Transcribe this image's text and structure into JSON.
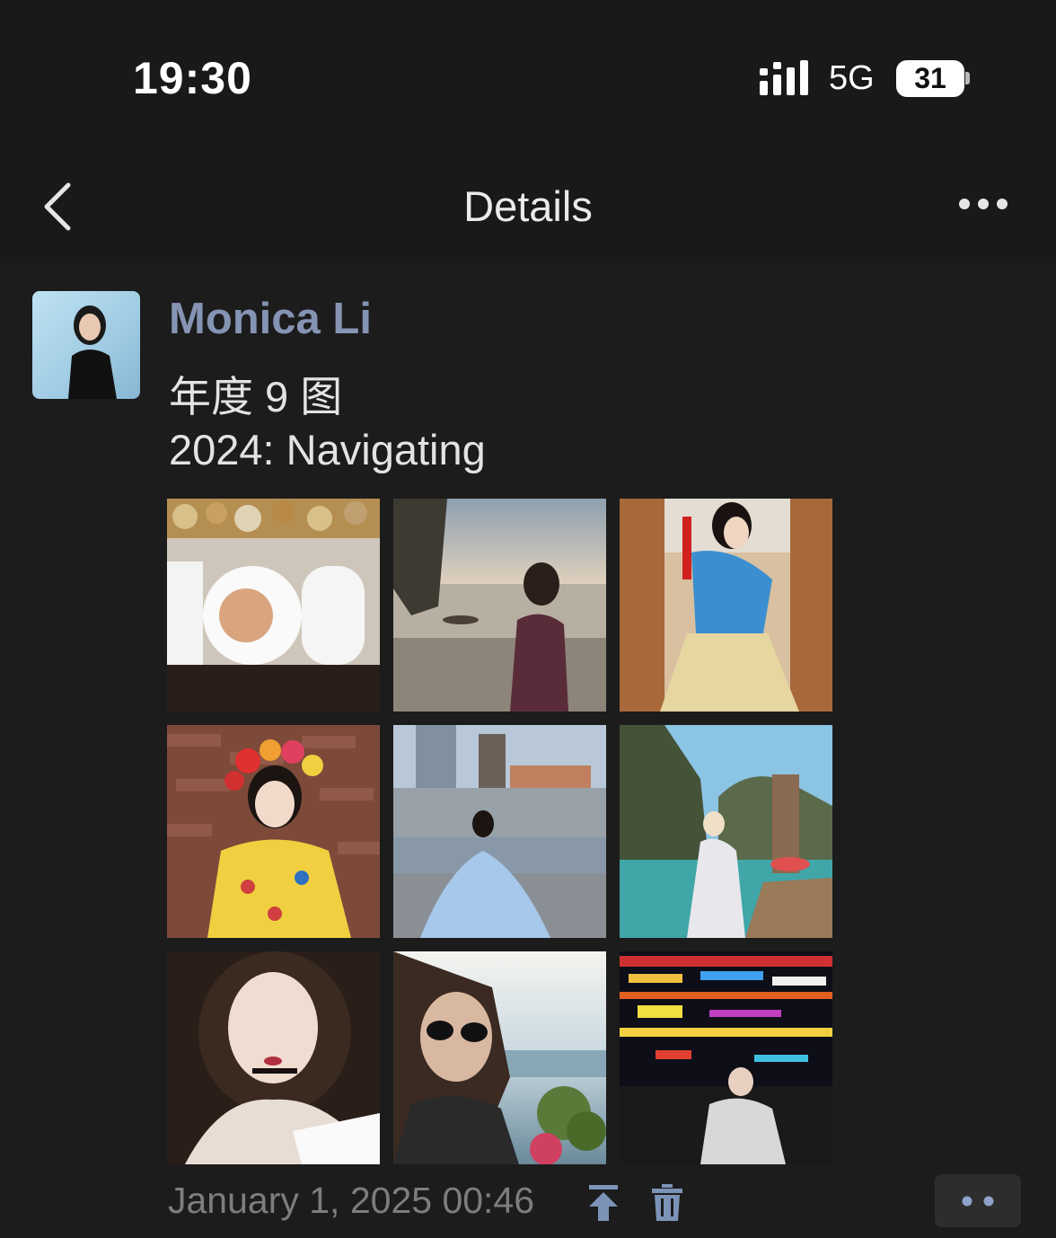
{
  "status_bar": {
    "time": "19:30",
    "network": "5G",
    "battery": "31"
  },
  "nav": {
    "title": "Details",
    "back_icon": "chevron-left-icon",
    "more_icon": "ellipsis-icon"
  },
  "post": {
    "author": "Monica Li",
    "line1": "年度 9 图",
    "line2": "2024: Navigating",
    "photos": [
      {
        "name": "photo-award-backdrop"
      },
      {
        "name": "photo-lakeside-sunset"
      },
      {
        "name": "photo-hanbok-portrait"
      },
      {
        "name": "photo-floral-crown"
      },
      {
        "name": "photo-blue-gown-bund"
      },
      {
        "name": "photo-boat-bay"
      },
      {
        "name": "photo-closeup-portrait"
      },
      {
        "name": "photo-sunglasses-selfie"
      },
      {
        "name": "photo-night-street"
      }
    ],
    "timestamp": "January 1, 2025 00:46",
    "pin_icon": "pin-to-top-icon",
    "delete_icon": "trash-icon",
    "comment_icon": "comment-dots-icon"
  }
}
